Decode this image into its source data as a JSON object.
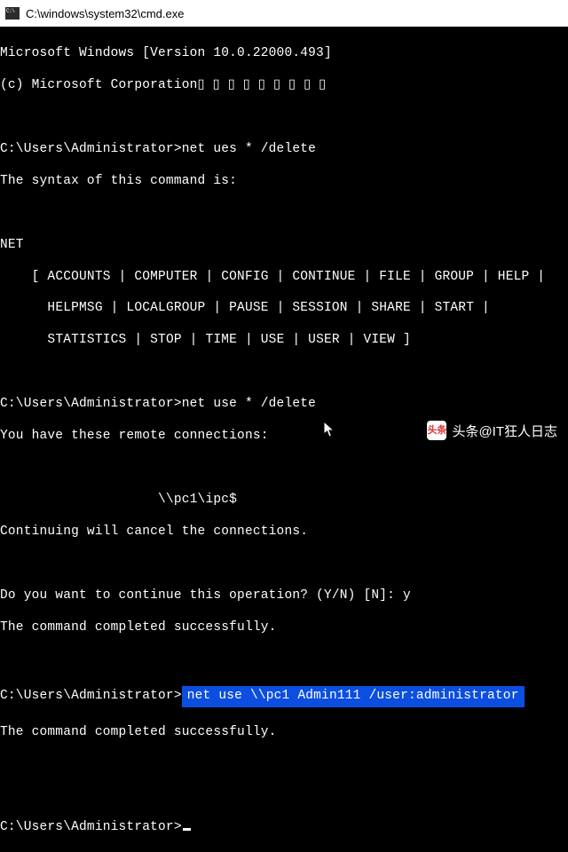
{
  "window": {
    "title": "C:\\windows\\system32\\cmd.exe"
  },
  "terminal": {
    "prompt": "C:\\Users\\Administrator>",
    "header_line1": "Microsoft Windows [Version 10.0.22000.493]",
    "header_line2": "(c) Microsoft Corporation▯ ▯ ▯ ▯ ▯ ▯ ▯ ▯ ▯",
    "cmd1": "net ues * /delete",
    "syntax_msg": "The syntax of this command is:",
    "net_header": "NET",
    "net_options1": "    [ ACCOUNTS | COMPUTER | CONFIG | CONTINUE | FILE | GROUP | HELP |",
    "net_options2": "      HELPMSG | LOCALGROUP | PAUSE | SESSION | SHARE | START |",
    "net_options3": "      STATISTICS | STOP | TIME | USE | USER | VIEW ]",
    "cmd2": "net use * /delete",
    "remote_msg": "You have these remote connections:",
    "connection": "                    \\\\pc1\\ipc$",
    "continuing_msg": "Continuing will cancel the connections.",
    "confirm_prompt": "Do you want to continue this operation? (Y/N) [N]: ",
    "confirm_answer": "y",
    "success_msg": "The command completed successfully.",
    "cmd3": "net use \\\\pc1 Admin111 /user:administrator",
    "success_msg2": "The command completed successfully."
  },
  "watermark": {
    "logo_text": "头条",
    "text": "头条@IT狂人日志"
  }
}
